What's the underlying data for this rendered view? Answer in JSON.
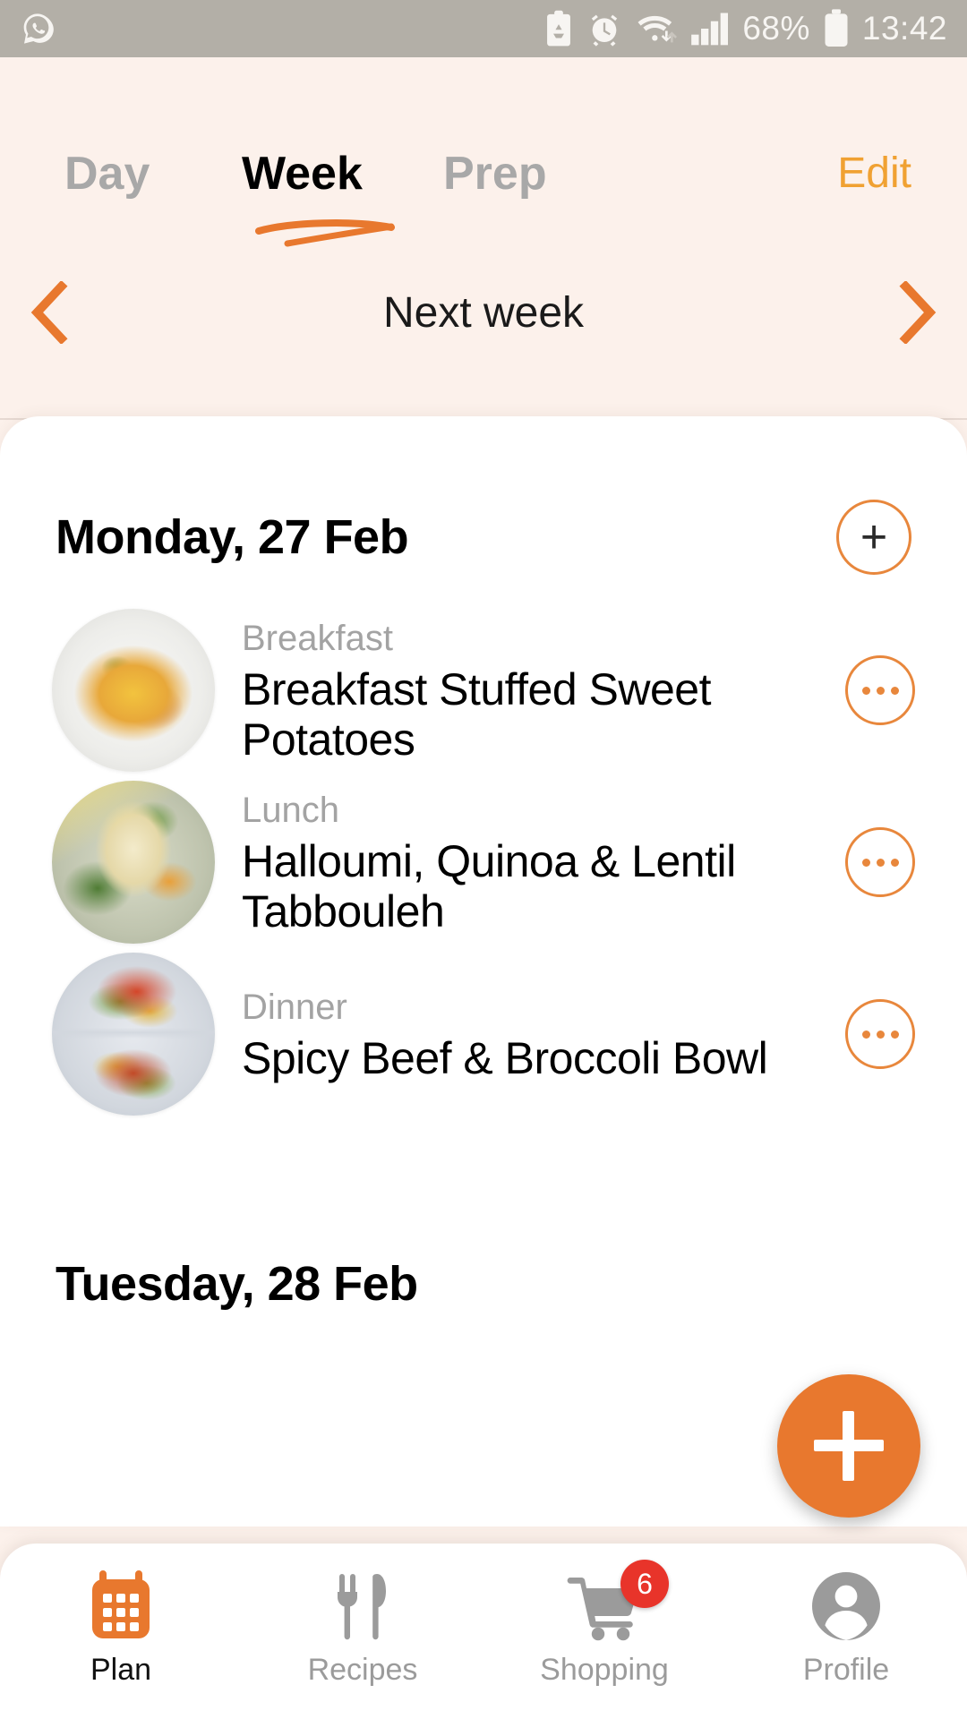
{
  "status_bar": {
    "app_icon": "whatsapp-icon",
    "icons": [
      "clipboard-recycle-icon",
      "alarm-clock-icon",
      "wifi-icon",
      "signal-bars-icon"
    ],
    "battery_percent": "68%",
    "battery_icon": "battery-icon",
    "time": "13:42"
  },
  "header": {
    "tabs": [
      {
        "label": "Day",
        "active": false
      },
      {
        "label": "Week",
        "active": true
      },
      {
        "label": "Prep",
        "active": false
      }
    ],
    "edit_label": "Edit",
    "week_nav": {
      "prev_icon": "chevron-left-icon",
      "label": "Next week",
      "next_icon": "chevron-right-icon"
    }
  },
  "plan": {
    "days": [
      {
        "title": "Monday, 27 Feb",
        "add_label": "+",
        "meals": [
          {
            "slot": "Breakfast",
            "title": "Breakfast Stuffed Sweet Potatoes",
            "menu_icon": "more-options-icon"
          },
          {
            "slot": "Lunch",
            "title": "Halloumi, Quinoa & Lentil Tabbouleh",
            "menu_icon": "more-options-icon"
          },
          {
            "slot": "Dinner",
            "title": "Spicy Beef & Broccoli Bowl",
            "menu_icon": "more-options-icon"
          }
        ]
      },
      {
        "title": "Tuesday, 28 Feb",
        "add_label": "+",
        "meals": []
      }
    ]
  },
  "fab": {
    "icon": "plus-icon"
  },
  "bottom_nav": {
    "items": [
      {
        "label": "Plan",
        "icon": "calendar-icon",
        "active": true,
        "badge": null
      },
      {
        "label": "Recipes",
        "icon": "fork-knife-icon",
        "active": false,
        "badge": null
      },
      {
        "label": "Shopping",
        "icon": "shopping-cart-icon",
        "active": false,
        "badge": "6"
      },
      {
        "label": "Profile",
        "icon": "person-icon",
        "active": false,
        "badge": null
      }
    ]
  },
  "colors": {
    "accent_orange": "#E8782E",
    "edit_orange": "#F0A132",
    "header_bg": "#FCF1EB",
    "badge_red": "#E8342A",
    "statusbar_bg": "#B3AFA7",
    "muted_gray": "#A3A3A3"
  }
}
